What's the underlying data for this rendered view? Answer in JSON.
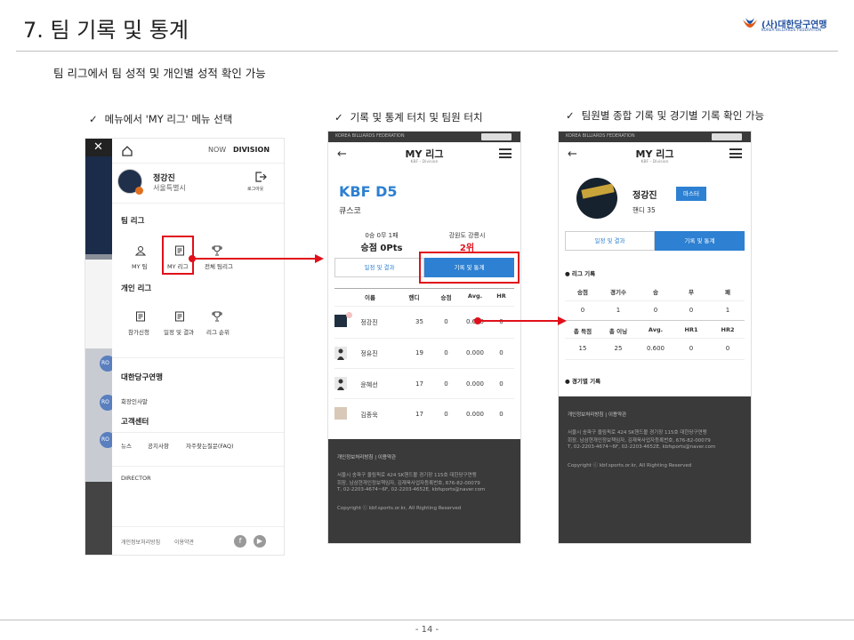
{
  "slide": {
    "title": "7. 팀 기록 및 통계",
    "subtitle": "팀 리그에서 팀 성적 및 개인별 성적 확인 가능",
    "page": "- 14 -",
    "logo_text": "(사)대한당구연맹",
    "logo_sub": "KOREA BILLIARDS FEDERATION"
  },
  "steps": [
    {
      "check": "✓",
      "label": "메뉴에서 'MY 리그' 메뉴 선택"
    },
    {
      "check": "✓",
      "label": "기록 및 통계 터치 및 팀원 터치"
    },
    {
      "check": "✓",
      "label": "팀원별 종합 기록 및 경기별 기록 확인 가능"
    }
  ],
  "menu": {
    "now": "NOW",
    "division": "DIVISION",
    "user_name": "정강진",
    "user_region": "서울특별시",
    "logout": "로그아웃",
    "team_league_title": "팀 리그",
    "team_items": [
      "MY 팀",
      "MY 리그",
      "전체 팀리그"
    ],
    "personal_league_title": "개인 리그",
    "personal_items": [
      "참가신청",
      "일정 및 결과",
      "리그 순위"
    ],
    "federation_title": "대한당구연맹",
    "federation_link": "회장인사말",
    "support_title": "고객센터",
    "support_links": [
      "뉴스",
      "공지사항",
      "자주찾는질문(FAQ)"
    ],
    "director": "DIRECTOR",
    "footer_links": [
      "개인정보처리방침",
      "이용약관"
    ],
    "bg_labels": [
      "RO",
      "RO",
      "RO"
    ]
  },
  "phone_header": {
    "federation": "KOREA BILLIARDS FEDERATION",
    "back": "←",
    "title": "MY 리그",
    "sub": "KBF - Division"
  },
  "team": {
    "name": "KBF D5",
    "club": "큐스코",
    "record": "0승 0무 1패",
    "points": "승점 0Pts",
    "region": "강원도 강릉시",
    "rank": "2위",
    "tab_schedule": "일정 및 결과",
    "tab_stats": "기록 및 통계",
    "columns": [
      "이름",
      "핸디",
      "승점",
      "Avg.",
      "HR"
    ],
    "players": [
      {
        "name": "정강진",
        "handi": "35",
        "points": "0",
        "avg": "0.600",
        "hr": "0"
      },
      {
        "name": "정유진",
        "handi": "19",
        "points": "0",
        "avg": "0.000",
        "hr": "0"
      },
      {
        "name": "윤혜선",
        "handi": "17",
        "points": "0",
        "avg": "0.000",
        "hr": "0"
      },
      {
        "name": "김종욱",
        "handi": "17",
        "points": "0",
        "avg": "0.000",
        "hr": "0"
      }
    ]
  },
  "footer": {
    "links": [
      "개인정보처리방침",
      "|",
      "이용약관"
    ],
    "address1": "서울시 송파구 올림픽로 424 SK핸드볼 경기장 115호 대한당구연맹",
    "address2": "회장, 남삼현개인정보책임자, 김재욱사업자등록번호, 676-82-00079",
    "address3": "T, 02-2203-4674~6F, 02-2203-4652E, kbfsports@naver.com",
    "copyright": "Copyright ⓒ kbf.sports.or.kr, All Righting Reserved"
  },
  "player": {
    "name": "정강진",
    "badge": "마스터",
    "handi": "핸디 35",
    "tab_schedule": "일정 및 결과",
    "tab_stats": "기록 및 통계",
    "league_record_title": "● 리그 기록",
    "league_cols1": [
      "승점",
      "경기수",
      "승",
      "무",
      "패"
    ],
    "league_vals1": [
      "0",
      "1",
      "0",
      "0",
      "1"
    ],
    "league_cols2": [
      "총 득점",
      "총 이닝",
      "Avg.",
      "HR1",
      "HR2"
    ],
    "league_vals2": [
      "15",
      "25",
      "0.600",
      "0",
      "0"
    ],
    "match_record_title": "● 경기별 기록"
  },
  "colors": {
    "accent": "#2d80d2",
    "highlight": "#e0101a",
    "rank": "#e0101a"
  }
}
